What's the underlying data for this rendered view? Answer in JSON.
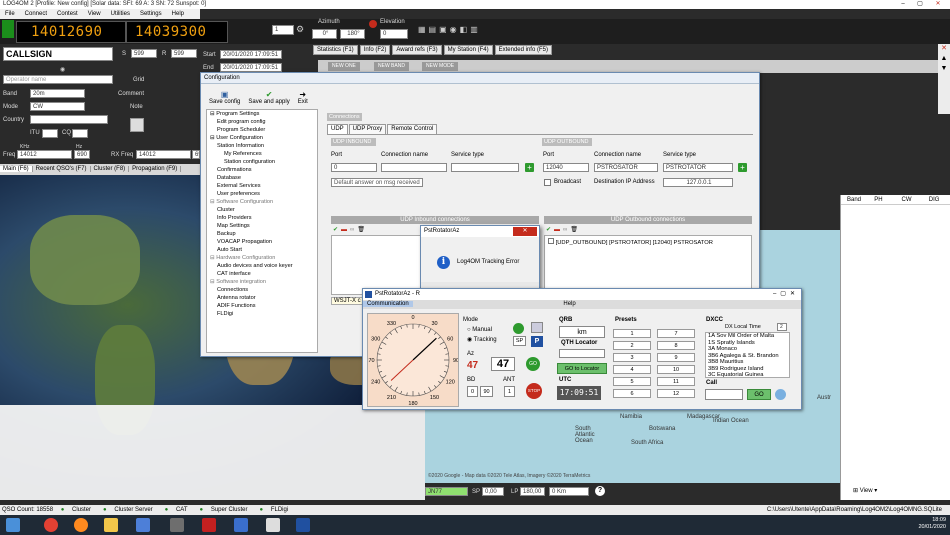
{
  "window": {
    "title": "LOG4OM 2 [Profile: New config] [Solar data: SFI: 69 A: 3 SN: 72 Sunspot: 0]"
  },
  "menu": [
    "File",
    "Connect",
    "Contest",
    "View",
    "Utilities",
    "Settings",
    "Help"
  ],
  "top": {
    "freq_rx": "14012690",
    "freq_tx": "14039300",
    "stepper": "1",
    "azimuth_label": "Azimuth",
    "az_values": [
      "0°",
      "180°"
    ],
    "elevation_label": "Elevation",
    "elevation_value": "0"
  },
  "left": {
    "callsign": "CALLSIGN",
    "s_label": "S",
    "s_value": "599",
    "r_label": "R",
    "r_value": "599",
    "start_label": "Start",
    "start_value": "20/01/2020 17:09:51",
    "end_label": "End",
    "end_value": "20/01/2020 17:09:51",
    "operator_placeholder": "Operator name",
    "grid_label": "Grid",
    "band_label": "Band",
    "band_value": "20m",
    "comment_label": "Comment",
    "mode_label": "Mode",
    "mode_value": "CW",
    "note_label": "Note",
    "country_label": "Country",
    "itu_label": "ITU",
    "cq_label": "CQ",
    "khz_label": "KHz",
    "hz_label": "Hz",
    "freq_label": "Freq",
    "freq_value": "14012",
    "freq_hz": "690",
    "rxfreq_label": "RX Freq",
    "rxfreq_value": "14012",
    "rxfreq_hz": "69"
  },
  "left_tabs": [
    "Main (F6)",
    "Recent QSO's (F7)",
    "Cluster (F8)",
    "Propagation (F9)"
  ],
  "stat_tabs": [
    "Statistics (F1)",
    "Info (F2)",
    "Award refs (F3)",
    "My Station (F4)",
    "Extended info (F5)"
  ],
  "new_buttons": [
    "NEW ONE",
    "NEW BAND",
    "NEW MODE"
  ],
  "config": {
    "title": "Configuration",
    "toolbar": [
      "Save config",
      "Save and apply",
      "Exit"
    ],
    "tree": [
      {
        "t": "Program Settings",
        "l": 0,
        "g": false
      },
      {
        "t": "Edit program config",
        "l": 1,
        "g": false
      },
      {
        "t": "Program Scheduler",
        "l": 1,
        "g": false
      },
      {
        "t": "User Configuration",
        "l": 0,
        "g": false
      },
      {
        "t": "Station Information",
        "l": 1,
        "g": false
      },
      {
        "t": "My References",
        "l": 2,
        "g": false
      },
      {
        "t": "Station configuration",
        "l": 2,
        "g": false
      },
      {
        "t": "Confirmations",
        "l": 1,
        "g": false
      },
      {
        "t": "Database",
        "l": 1,
        "g": false
      },
      {
        "t": "External Services",
        "l": 1,
        "g": false
      },
      {
        "t": "User preferences",
        "l": 1,
        "g": false
      },
      {
        "t": "Software Configuration",
        "l": 0,
        "g": true
      },
      {
        "t": "Cluster",
        "l": 1,
        "g": false
      },
      {
        "t": "Info Providers",
        "l": 1,
        "g": false
      },
      {
        "t": "Map Settings",
        "l": 1,
        "g": false
      },
      {
        "t": "Backup",
        "l": 1,
        "g": false
      },
      {
        "t": "VOACAP Propagation",
        "l": 1,
        "g": false
      },
      {
        "t": "Auto Start",
        "l": 1,
        "g": false
      },
      {
        "t": "Hardware Configuration",
        "l": 0,
        "g": true
      },
      {
        "t": "Audio devices and voice keyer",
        "l": 1,
        "g": false
      },
      {
        "t": "CAT interface",
        "l": 1,
        "g": false
      },
      {
        "t": "Software integration",
        "l": 0,
        "g": true
      },
      {
        "t": "Connections",
        "l": 1,
        "g": false
      },
      {
        "t": "Antenna rotator",
        "l": 1,
        "g": false
      },
      {
        "t": "ADIF Functions",
        "l": 1,
        "g": false
      },
      {
        "t": "FLDigi",
        "l": 1,
        "g": false
      }
    ],
    "connections_header": "Connections",
    "tabs": [
      "UDP",
      "UDP Proxy",
      "Remote Control"
    ],
    "inbound_header": "UDP INBOUND",
    "outbound_header": "UDP OUTBOUND",
    "port_label": "Port",
    "connname_label": "Connection name",
    "service_label": "Service type",
    "in_port": "0",
    "in_default": "Default answer on msg received",
    "out_port": "12040",
    "out_name": "PSTROSATOR",
    "out_service": "PSTROTATOR",
    "broadcast_label": "Broadcast",
    "dest_ip_label": "Destination IP Address",
    "dest_ip": "127.0.0.1",
    "inbound_list_header": "UDP Inbound connections",
    "outbound_list_header": "UDP Outbound connections",
    "outbound_item": "[UDP_OUTBOUND] [PSTROTATOR] [12040] PSTROSATOR",
    "wsjt_partial": "WSJT-X c"
  },
  "error": {
    "title": "PstRotatorAz",
    "close": "✕",
    "message": "Log4OM Tracking Error",
    "ok": "OK"
  },
  "rotator": {
    "title": "PstRotatorAz - R",
    "tabs": [
      "Communication",
      "Help"
    ],
    "dial_labels": [
      "0",
      "30",
      "60",
      "90",
      "120",
      "150",
      "180",
      "210",
      "240",
      "270",
      "300",
      "330"
    ],
    "mode_label": "Mode",
    "manual": "Manual",
    "tracking": "Tracking",
    "sp": "SP",
    "az_label": "Az",
    "az_red": "47",
    "az_black": "47",
    "go": "GO",
    "bd_label": "BD",
    "bd_values": [
      "0",
      "90"
    ],
    "ant_label": "ANT",
    "ant_value": "1",
    "stop": "STOP",
    "qrb_label": "QRB",
    "km": "km",
    "qth_label": "QTH Locator",
    "go_locator": "GO to Locator",
    "utc_label": "UTC",
    "utc_value": "17:09:51",
    "presets_label": "Presets",
    "presets": [
      "1",
      "7",
      "2",
      "8",
      "3",
      "9",
      "4",
      "10",
      "5",
      "11",
      "6",
      "12"
    ],
    "dxcc_label": "DXCC",
    "dx_local_time": "DX Local Time",
    "dx_hour": "2",
    "dxcc_list": [
      "1A  Sov Mil Order of Malta",
      "1S  Spratly Islands",
      "3A  Monaco",
      "3B6 Agalega & St. Brandon",
      "3B8 Mauritius",
      "3B9 Rodriguez Island",
      "3C  Equatorial Guinea"
    ],
    "call_label": "Call",
    "call_go": "GO"
  },
  "map_labels": {
    "namibia": "Namibia",
    "botswana": "Botswana",
    "south_africa": "South Africa",
    "madagascar": "Madagascar",
    "indian_ocean": "Indian Ocean",
    "south_atlantic": "South Atlantic Ocean",
    "australia": "Austr",
    "copyright": "©2020 Google - Map data ©2020 Tele Atlas, Imagery ©2020 TerraMetrics"
  },
  "loc": {
    "locator": "JN77",
    "sp_label": "SP",
    "sp_value": "0,00",
    "lp_label": "LP",
    "lp_value": "180,00",
    "km": "0 Km",
    "help": "?"
  },
  "right_cols": [
    "Band",
    "PH",
    "CW",
    "DIG"
  ],
  "view_label": "View",
  "status": {
    "qso_count": "QSO Count: 18558",
    "items": [
      "Cluster",
      "Cluster Server",
      "CAT",
      "Super Cluster",
      "FLDigi"
    ],
    "path": "C:\\Users\\Utente\\AppData\\Roaming\\Log4OM2\\Log4OMNG.SQLite"
  },
  "clock": {
    "time": "18:09",
    "date": "20/01/2020"
  },
  "colors": {
    "lcd": "#f0a010",
    "green": "#2e9a2e",
    "red": "#c42b1c",
    "locator_bg": "#90e070"
  }
}
